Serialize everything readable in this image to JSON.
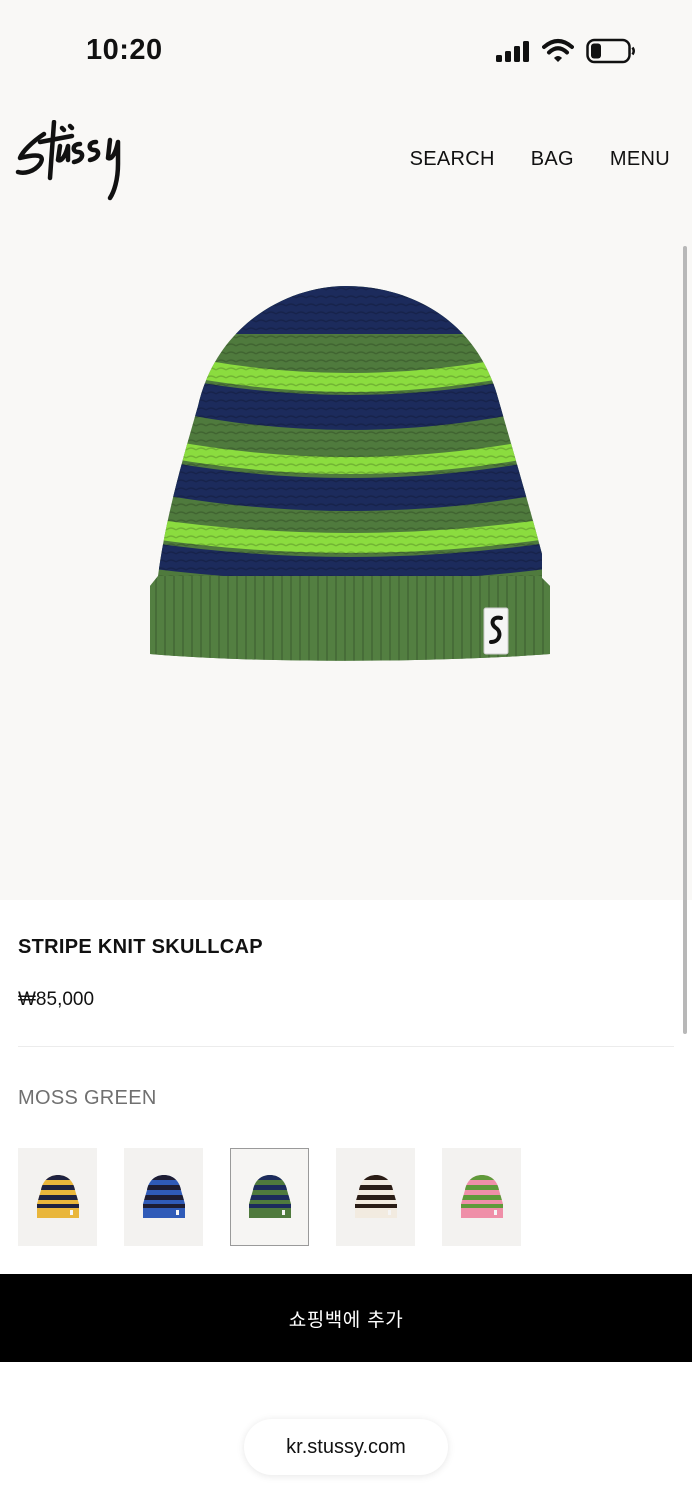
{
  "status_bar": {
    "time": "10:20"
  },
  "header": {
    "logo": "Stussy",
    "nav": {
      "search": "SEARCH",
      "bag": "BAG",
      "menu": "MENU"
    }
  },
  "product": {
    "title": "STRIPE KNIT SKULLCAP",
    "price": "₩85,000",
    "selected_color": "MOSS GREEN",
    "image": {
      "icon": "beanie-image",
      "colors": {
        "base": "#4f7a3d",
        "navy": "#1c2b5c",
        "lime": "#8bdc3f"
      }
    }
  },
  "swatches": [
    {
      "name": "swatch-yellow",
      "base": "#e9b63b",
      "stripe": "#1e2240",
      "selected": false
    },
    {
      "name": "swatch-blue",
      "base": "#2f5bb8",
      "stripe": "#1d1d33",
      "selected": false
    },
    {
      "name": "swatch-moss-green",
      "base": "#4f7a3d",
      "stripe": "#1c2b5c",
      "selected": true
    },
    {
      "name": "swatch-cream",
      "base": "#f2ebe0",
      "stripe": "#2a1d16",
      "selected": false
    },
    {
      "name": "swatch-pink",
      "base": "#ef8fa8",
      "stripe": "#5f9a3a",
      "selected": false
    }
  ],
  "cta": {
    "add_to_bag": "쇼핑백에 추가"
  },
  "browser": {
    "url": "kr.stussy.com"
  }
}
